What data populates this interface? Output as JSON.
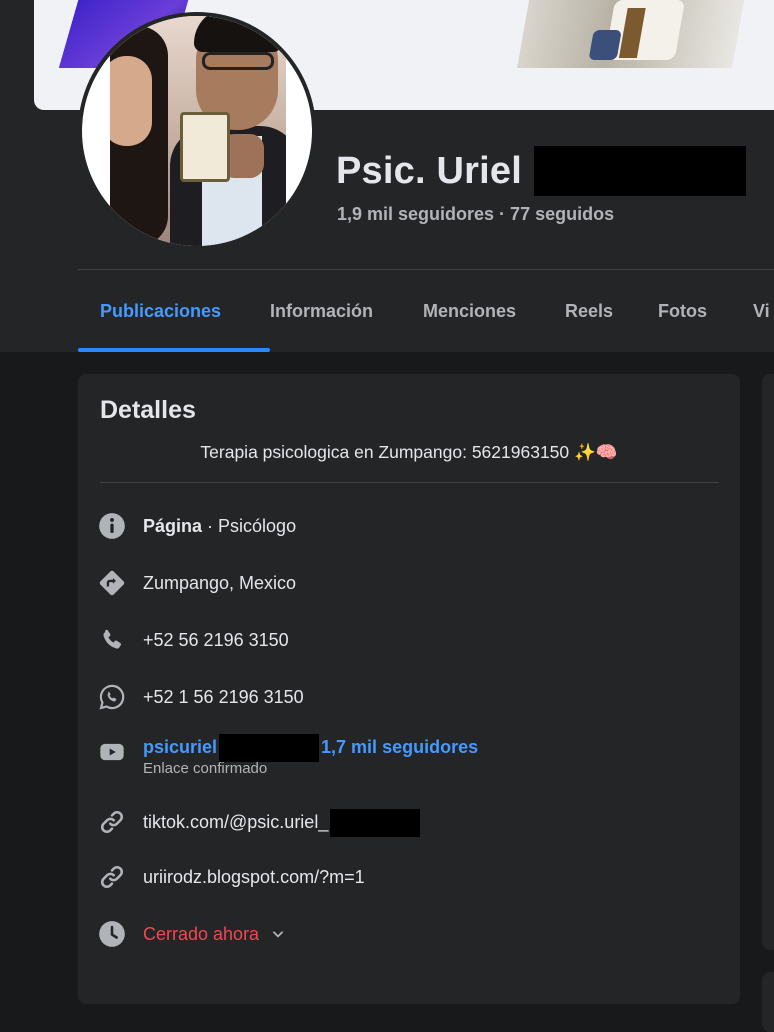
{
  "profile": {
    "name": "Psic. Uriel",
    "followers_line": "1,9 mil seguidores · 77 seguidos"
  },
  "tabs": [
    {
      "label": "Publicaciones",
      "active": true
    },
    {
      "label": "Información"
    },
    {
      "label": "Menciones"
    },
    {
      "label": "Reels"
    },
    {
      "label": "Fotos"
    },
    {
      "label": "Vi"
    }
  ],
  "details": {
    "title": "Detalles",
    "bio": "Terapia psicologica en Zumpango: 5621963150 ✨🧠",
    "page_label": "Página",
    "page_category": " · Psicólogo",
    "address": "Zumpango, Mexico",
    "phone": "+52 56 2196 3150",
    "whatsapp": "+52 1 56 2196 3150",
    "youtube_handle": "psicuriel",
    "youtube_followers": "1,7 mil seguidores",
    "youtube_note": "Enlace confirmado",
    "tiktok": "tiktok.com/@psic.uriel_",
    "blog": "uriirodz.blogspot.com/?m=1",
    "hours": "Cerrado ahora"
  },
  "colors": {
    "background": "#18191a",
    "card": "#242526",
    "accent": "#2d88ff",
    "link": "#4599ff",
    "closed": "#f0484e"
  },
  "icons": [
    "info-icon",
    "directions-icon",
    "phone-icon",
    "whatsapp-icon",
    "youtube-icon",
    "link-icon",
    "clock-icon",
    "chevron-down-icon"
  ]
}
